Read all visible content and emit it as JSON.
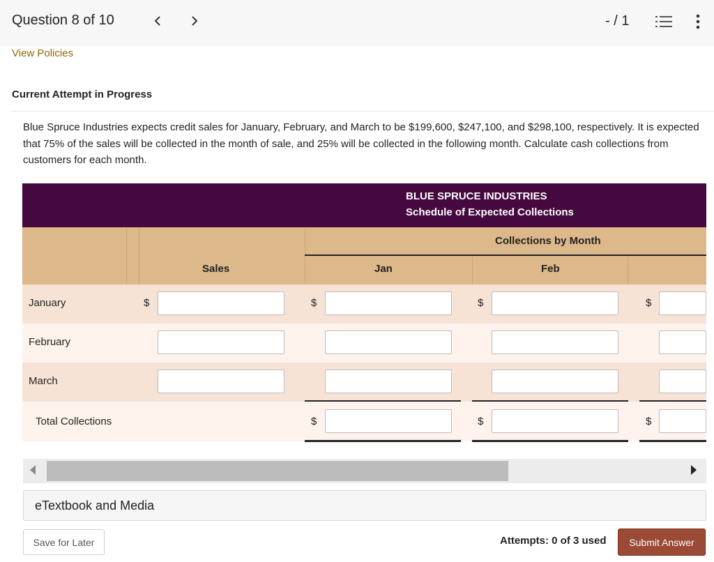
{
  "header": {
    "question_label": "Question 8 of 10",
    "prev_icon": "chevron-left-icon",
    "next_icon": "chevron-right-icon",
    "score": "- / 1",
    "list_icon": "numbered-list-icon",
    "more_icon": "vertical-ellipsis-icon"
  },
  "links": {
    "view_policies": "View Policies"
  },
  "attempt_status": "Current Attempt in Progress",
  "problem_text": "Blue Spruce Industries expects credit sales for January, February, and March to be $199,600, $247,100, and $298,100, respectively. It is expected that 75% of the sales will be collected in the month of sale, and 25% will be collected in the following month. Calculate cash collections from customers for each month.",
  "table": {
    "company": "BLUE SPRUCE INDUSTRIES",
    "schedule": "Schedule of Expected Collections",
    "group_header": "Collections by Month",
    "columns": [
      "Sales",
      "Jan",
      "Feb"
    ],
    "rows": [
      {
        "label": "January",
        "values": [
          "",
          "",
          "",
          ""
        ]
      },
      {
        "label": "February",
        "values": [
          "",
          "",
          "",
          ""
        ]
      },
      {
        "label": "March",
        "values": [
          "",
          "",
          "",
          ""
        ]
      }
    ],
    "total_label": "Total Collections",
    "currency_symbol": "$"
  },
  "etextbook_label": "eTextbook and Media",
  "footer": {
    "save_label": "Save for Later",
    "attempts": "Attempts: 0 of 3 used",
    "submit_label": "Submit Answer"
  },
  "colors": {
    "header_purple": "#45083f",
    "header_tan": "#dcb88b",
    "row_peach": "#f7e3d6",
    "row_light": "#fdf3ec",
    "submit_brown": "#9b4a35",
    "link_gold": "#8a6a00"
  }
}
